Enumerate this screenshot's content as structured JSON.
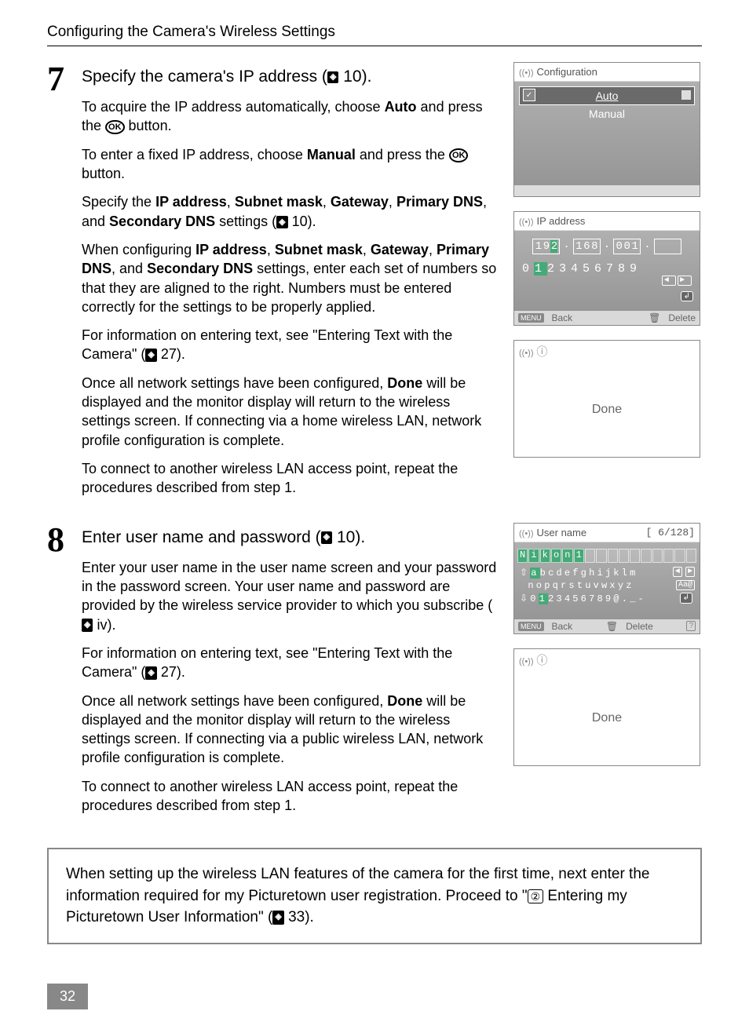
{
  "header": {
    "section_title": "Configuring the Camera's Wireless Settings"
  },
  "step7": {
    "number": "7",
    "heading_prefix": "Specify the camera's IP address (",
    "heading_ref": "10",
    "heading_suffix": ").",
    "p1_a": "To acquire the IP address automatically, choose ",
    "p1_bold": "Auto",
    "p1_b": " and press the ",
    "p1_c": " button.",
    "p2_a": "To enter a fixed IP address, choose ",
    "p2_bold": "Manual",
    "p2_b": " and press the ",
    "p2_c": " button.",
    "p3_a": "Specify the ",
    "p3_b1": "IP address",
    "p3_s1": ", ",
    "p3_b2": "Subnet mask",
    "p3_s2": ", ",
    "p3_b3": "Gateway",
    "p3_s3": ", ",
    "p3_b4": "Primary DNS",
    "p3_s4": ", and ",
    "p3_b5": "Secondary DNS",
    "p3_c": " settings (",
    "p3_ref": "10",
    "p3_d": ").",
    "p4_a": "When configuring ",
    "p4_b1": "IP address",
    "p4_s1": ", ",
    "p4_b2": "Subnet mask",
    "p4_s2": ", ",
    "p4_b3": "Gateway",
    "p4_s3": ", ",
    "p4_b4": "Primary DNS",
    "p4_s4": ", and ",
    "p4_b5": "Secondary DNS",
    "p4_c": " settings, enter each set of numbers so that they are aligned to the right. Numbers must be entered correctly for the settings to be properly applied.",
    "p5_a": "For information on entering text, see \"Entering Text with the Camera\" (",
    "p5_ref": "27",
    "p5_b": ").",
    "p6_a": "Once all network settings have been configured, ",
    "p6_bold": "Done",
    "p6_b": " will be displayed and the monitor display will return to the wireless settings screen. If connecting via a home wireless LAN, network profile configuration is complete.",
    "p7": "To connect to another wireless LAN access point, repeat the procedures described from step 1."
  },
  "step8": {
    "number": "8",
    "heading_prefix": "Enter user name and password (",
    "heading_ref": "10",
    "heading_suffix": ").",
    "p1_a": "Enter your user name in the user name screen and your password in the password screen. Your user name and password are provided by the wireless service provider to which you subscribe (",
    "p1_ref": "iv",
    "p1_b": ").",
    "p2_a": "For information on entering text, see \"Entering Text with the Camera\" (",
    "p2_ref": "27",
    "p2_b": ").",
    "p3_a": "Once all network settings have been configured, ",
    "p3_bold": "Done",
    "p3_b": " will be displayed and the monitor display will return to the wireless settings screen. If connecting via a public wireless LAN, network profile configuration is complete.",
    "p4": "To connect to another wireless LAN access point, repeat the procedures described from step 1."
  },
  "note": {
    "a": "When setting up the wireless LAN features of the camera for the first time, next enter the information required for my Picturetown user registration. Proceed to \"",
    "step_no": "②",
    "b": " Entering my Picturetown User Information\" (",
    "ref": "33",
    "c": ")."
  },
  "page_number": "32",
  "screens": {
    "config": {
      "title": "Configuration",
      "opt1": "Auto",
      "opt2": "Manual"
    },
    "ipaddr": {
      "title": "IP address",
      "octets": [
        "192",
        "168",
        "001",
        ""
      ],
      "digits": "0123456789",
      "back_btn": "MENU",
      "back_label": "Back",
      "delete_label": "Delete"
    },
    "done": {
      "text": "Done"
    },
    "username": {
      "title": "User name",
      "counter": "[   6/128]",
      "value": "Nikon1",
      "row1_pre": "⇧",
      "row1": "abcdefghijklm",
      "row2": "nopqrstuvwxyz",
      "row2_aa": "Aa@",
      "row3_pre": "⇩",
      "row3": "0123456789@._-",
      "back_btn": "MENU",
      "back_label": "Back",
      "delete_label": "Delete"
    }
  },
  "icons": {
    "ok": "OK",
    "page_ref": "◈"
  }
}
